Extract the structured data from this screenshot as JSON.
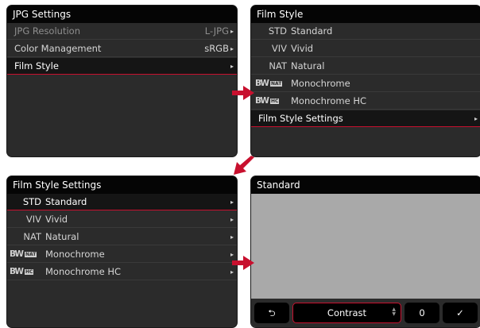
{
  "screen1": {
    "title": "JPG Settings",
    "rows": [
      {
        "label": "JPG Resolution",
        "value": "L-JPG",
        "chevron": "▸"
      },
      {
        "label": "Color Management",
        "value": "sRGB",
        "chevron": "▸"
      },
      {
        "label": "Film Style",
        "chevron": "▸"
      }
    ]
  },
  "screen2": {
    "title": "Film Style",
    "items": [
      {
        "code": "STD",
        "name": "Standard"
      },
      {
        "code": "VIV",
        "name": "Vivid"
      },
      {
        "code": "NAT",
        "name": "Natural"
      },
      {
        "code": "BW",
        "sub": "NAT",
        "name": "Monochrome"
      },
      {
        "code": "BW",
        "sub": "HC",
        "name": "Monochrome HC"
      }
    ],
    "settings_label": "Film Style Settings",
    "settings_chevron": "▸"
  },
  "screen3": {
    "title": "Film Style Settings",
    "items": [
      {
        "code": "STD",
        "name": "Standard",
        "chevron": "▸"
      },
      {
        "code": "VIV",
        "name": "Vivid",
        "chevron": "▸"
      },
      {
        "code": "NAT",
        "name": "Natural",
        "chevron": "▸"
      },
      {
        "code": "BW",
        "sub": "NAT",
        "name": "Monochrome",
        "chevron": "▸"
      },
      {
        "code": "BW",
        "sub": "HC",
        "name": "Monochrome HC",
        "chevron": "▸"
      }
    ]
  },
  "screen4": {
    "title": "Standard",
    "back_icon": "back-arrow-icon",
    "back_glyph": "⮌",
    "contrast_label": "Contrast",
    "stepper_up": "▲",
    "stepper_down": "▼",
    "value": "0",
    "ok_glyph": "✓"
  },
  "colors": {
    "accent": "#c8102e",
    "screen_bg": "#2b2b2b",
    "title_bg": "#050505",
    "preview_bg": "#a9a9a9"
  }
}
